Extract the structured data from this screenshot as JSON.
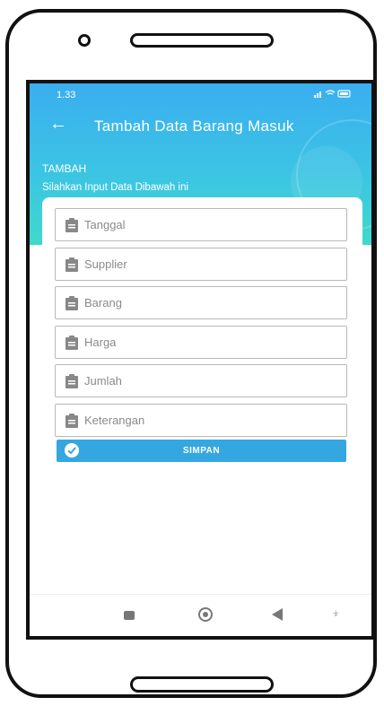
{
  "status_bar": {
    "time": "1.33",
    "icons": "signal wifi battery"
  },
  "appbar": {
    "back_icon": "arrow-left-icon",
    "title": "Tambah Data Barang Masuk"
  },
  "section": {
    "title": "TAMBAH",
    "subtitle": "Silahkan Input Data Dibawah ini"
  },
  "form": {
    "fields": [
      {
        "placeholder": "Tanggal"
      },
      {
        "placeholder": "Supplier"
      },
      {
        "placeholder": "Barang"
      },
      {
        "placeholder": "Harga"
      },
      {
        "placeholder": "Jumlah"
      },
      {
        "placeholder": "Keterangan"
      }
    ],
    "submit_label": "SIMPAN"
  },
  "colors": {
    "header_top": "#3aaef0",
    "header_bottom": "#3fd9cb",
    "button": "#35a7e0"
  }
}
